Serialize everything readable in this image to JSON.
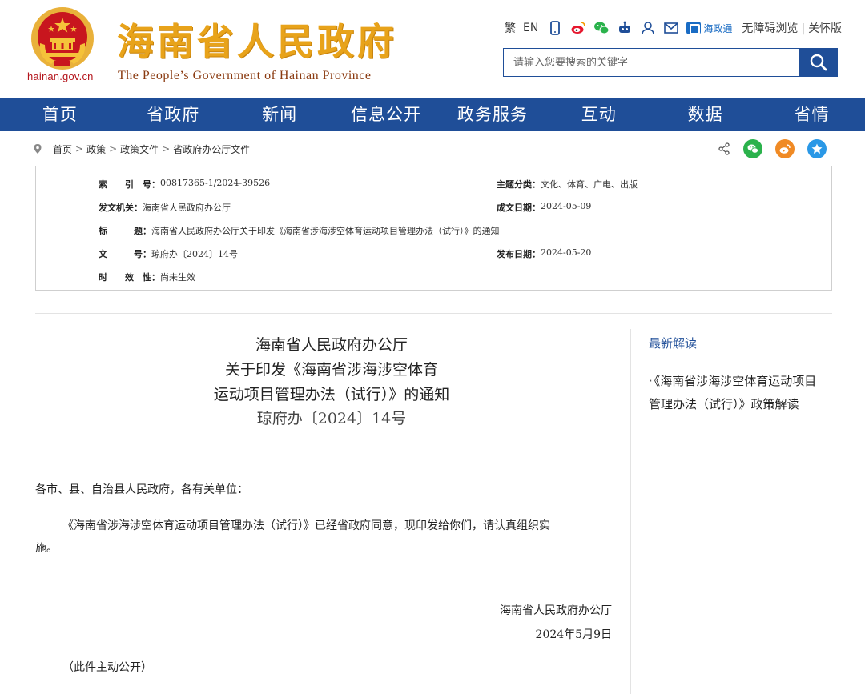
{
  "header": {
    "domain": "hainan.gov.cn",
    "title": "海南省人民政府",
    "subtitle": "The People’s Government  of Hainan Province",
    "tools": {
      "traditional": "繁",
      "english": "EN",
      "haizhengtong": "海政通",
      "accessible": "无障碍浏览",
      "separator": "|",
      "elder": "关怀版"
    },
    "search_placeholder": "请输入您要搜索的关键字"
  },
  "nav": [
    "首页",
    "省政府",
    "新闻",
    "信息公开",
    "政务服务",
    "互动",
    "数据",
    "省情"
  ],
  "breadcrumb": [
    "首页",
    "政策",
    "政策文件",
    "省政府办公厅文件"
  ],
  "breadcrumb_sep": ">",
  "meta": {
    "index_key": "索　　引　号：",
    "index_val": "00817365-1/2024-39526",
    "topic_key": "主题分类：",
    "topic_val": "文化、体育、广电、出版",
    "issuer_key": "发文机关：",
    "issuer_val": "海南省人民政府办公厅",
    "date_key": "成文日期：",
    "date_val": "2024-05-09",
    "title_key": "标　　　题：",
    "title_val": "海南省人民政府办公厅关于印发《海南省涉海涉空体育运动项目管理办法（试行）》的通知",
    "docno_key": "文　　　号：",
    "docno_val": "琼府办〔2024〕14号",
    "pub_key": "发布日期：",
    "pub_val": "2024-05-20",
    "valid_key": "时　　效　性：",
    "valid_val": "尚未生效"
  },
  "article": {
    "title_line1": "海南省人民政府办公厅",
    "title_line2": "关于印发《海南省涉海涉空体育",
    "title_line3": "运动项目管理办法（试行）》的通知",
    "doc_number": "琼府办〔2024〕14号",
    "salutation": "各市、县、自治县人民政府，各有关单位：",
    "body_line1": "《海南省涉海涉空体育运动项目管理办法（试行）》已经省政府同意，现印发给你们，请认真组织实",
    "body_line2": "施。",
    "signer": "海南省人民政府办公厅",
    "sign_date": "2024年5月9日",
    "note": "（此件主动公开）"
  },
  "sidebar": {
    "title": "最新解读",
    "link_line1": "《海南省涉海涉空体育运动项目",
    "link_line2": "管理办法（试行）》政策解读",
    "bullet": "·"
  },
  "colors": {
    "primary": "#1f4e98",
    "title_gold": "#e8a31a",
    "emblem_red": "#c8161e"
  }
}
